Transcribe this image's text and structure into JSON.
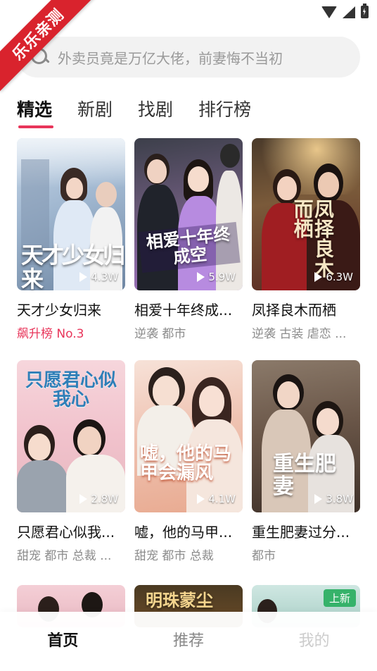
{
  "ribbon": {
    "label": "乐乐亲测"
  },
  "search": {
    "placeholder": "外卖员竟是万亿大佬，前妻悔不当初"
  },
  "tabs": [
    {
      "label": "精选",
      "active": true
    },
    {
      "label": "新剧",
      "active": false
    },
    {
      "label": "找剧",
      "active": false
    },
    {
      "label": "排行榜",
      "active": false
    }
  ],
  "cards": [
    {
      "title": "天才少女归来",
      "subtitle": "飙升榜 No.3",
      "plays": "4.3W",
      "poster_text": "天才少女归来"
    },
    {
      "title": "相爱十年终成...",
      "subtitle": "逆袭 都市",
      "plays": "5.9W",
      "poster_text": "相爱十年终成空"
    },
    {
      "title": "凤择良木而栖",
      "subtitle": "逆袭 古装 虐恋 ...",
      "plays": "6.3W",
      "poster_text": "凤择良木而栖"
    },
    {
      "title": "只愿君心似我...",
      "subtitle": "甜宠 都市 总裁 ...",
      "plays": "2.8W",
      "poster_text": "只愿君心似我心"
    },
    {
      "title": "嘘，他的马甲...",
      "subtitle": "甜宠 都市 总裁",
      "plays": "4.1W",
      "poster_text": "嘘，他的马甲会漏风"
    },
    {
      "title": "重生肥妻过分...",
      "subtitle": "都市",
      "plays": "3.8W",
      "poster_text": "重生肥妻"
    }
  ],
  "partial_cards": [
    {
      "poster_text": ""
    },
    {
      "poster_text": "明珠蒙尘"
    },
    {
      "badge": "上新"
    }
  ],
  "bottom_nav": [
    {
      "label": "首页",
      "active": true
    },
    {
      "label": "推荐",
      "active": false
    },
    {
      "label": "我的",
      "active": false
    }
  ],
  "colors": {
    "accent": "#e8355a",
    "ribbon": "#d9232d",
    "new_badge": "#36b26a"
  }
}
